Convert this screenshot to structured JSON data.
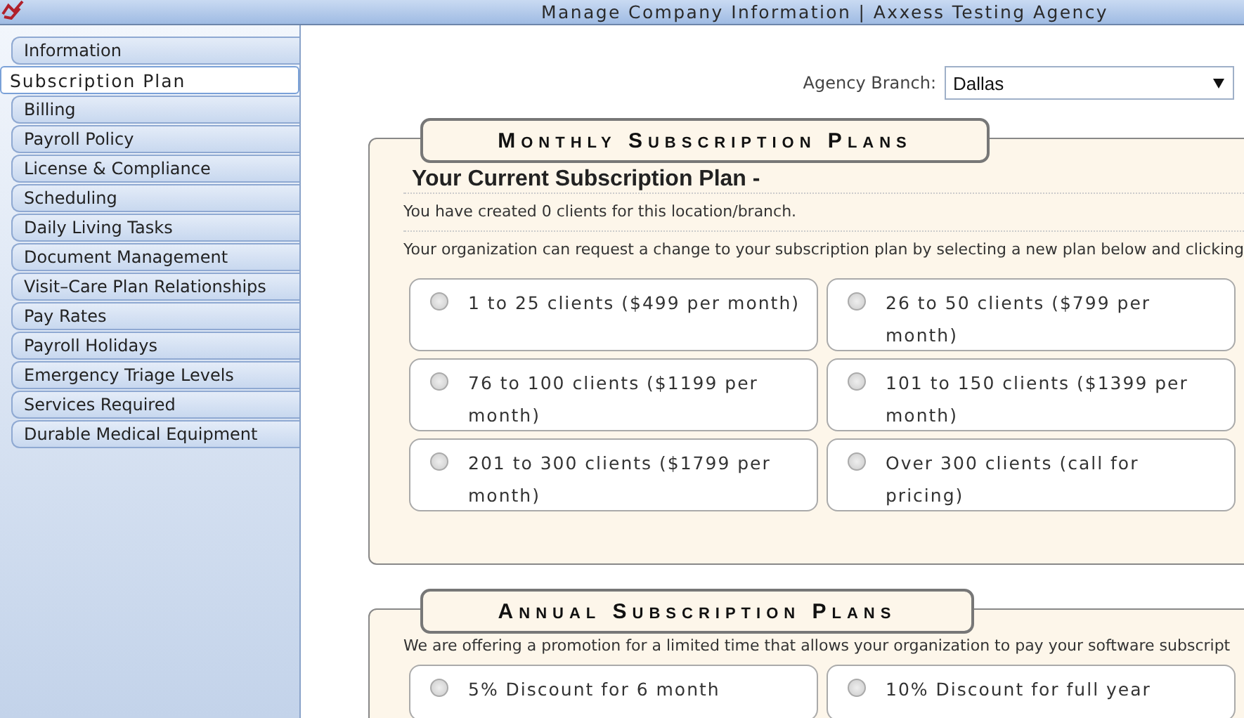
{
  "window": {
    "title": "Manage Company Information | Axxess Testing Agency"
  },
  "sidebar": {
    "items": [
      {
        "label": "Information",
        "selected": false
      },
      {
        "label": "Subscription Plan",
        "selected": true
      },
      {
        "label": "Billing",
        "selected": false
      },
      {
        "label": "Payroll Policy",
        "selected": false
      },
      {
        "label": "License & Compliance",
        "selected": false
      },
      {
        "label": "Scheduling",
        "selected": false
      },
      {
        "label": "Daily Living Tasks",
        "selected": false
      },
      {
        "label": "Document Management",
        "selected": false
      },
      {
        "label": "Visit–Care Plan Relationships",
        "selected": false
      },
      {
        "label": "Pay Rates",
        "selected": false
      },
      {
        "label": "Payroll Holidays",
        "selected": false
      },
      {
        "label": "Emergency Triage Levels",
        "selected": false
      },
      {
        "label": "Services Required",
        "selected": false
      },
      {
        "label": "Durable Medical Equipment",
        "selected": false
      }
    ]
  },
  "branch": {
    "label": "Agency Branch:",
    "value": "Dallas"
  },
  "monthly": {
    "legend": "Monthly Subscription Plans",
    "heading": "Your Current Subscription Plan -",
    "notes": [
      "You have created 0 clients for this location/branch.",
      "Your organization can request a change to your subscription plan by selecting a new plan below and clicking"
    ],
    "plans": [
      {
        "label": "1 to 25 clients ($499 per month)",
        "selected": false
      },
      {
        "label": "26 to 50 clients ($799 per month)",
        "selected": false
      },
      {
        "label": "76 to 100 clients ($1199 per month)",
        "selected": false
      },
      {
        "label": "101 to 150 clients ($1399 per month)",
        "selected": false
      },
      {
        "label": "201 to 300 clients ($1799 per month)",
        "selected": false
      },
      {
        "label": "Over 300 clients (call for pricing)",
        "selected": false
      }
    ]
  },
  "annual": {
    "legend": "Annual Subscription Plans",
    "note": "We are offering a promotion for a limited time that allows your organization to pay your software subscript",
    "plans": [
      {
        "label": "5% Discount for 6 month",
        "selected": false
      },
      {
        "label": "10% Discount for full year",
        "selected": false
      }
    ]
  }
}
